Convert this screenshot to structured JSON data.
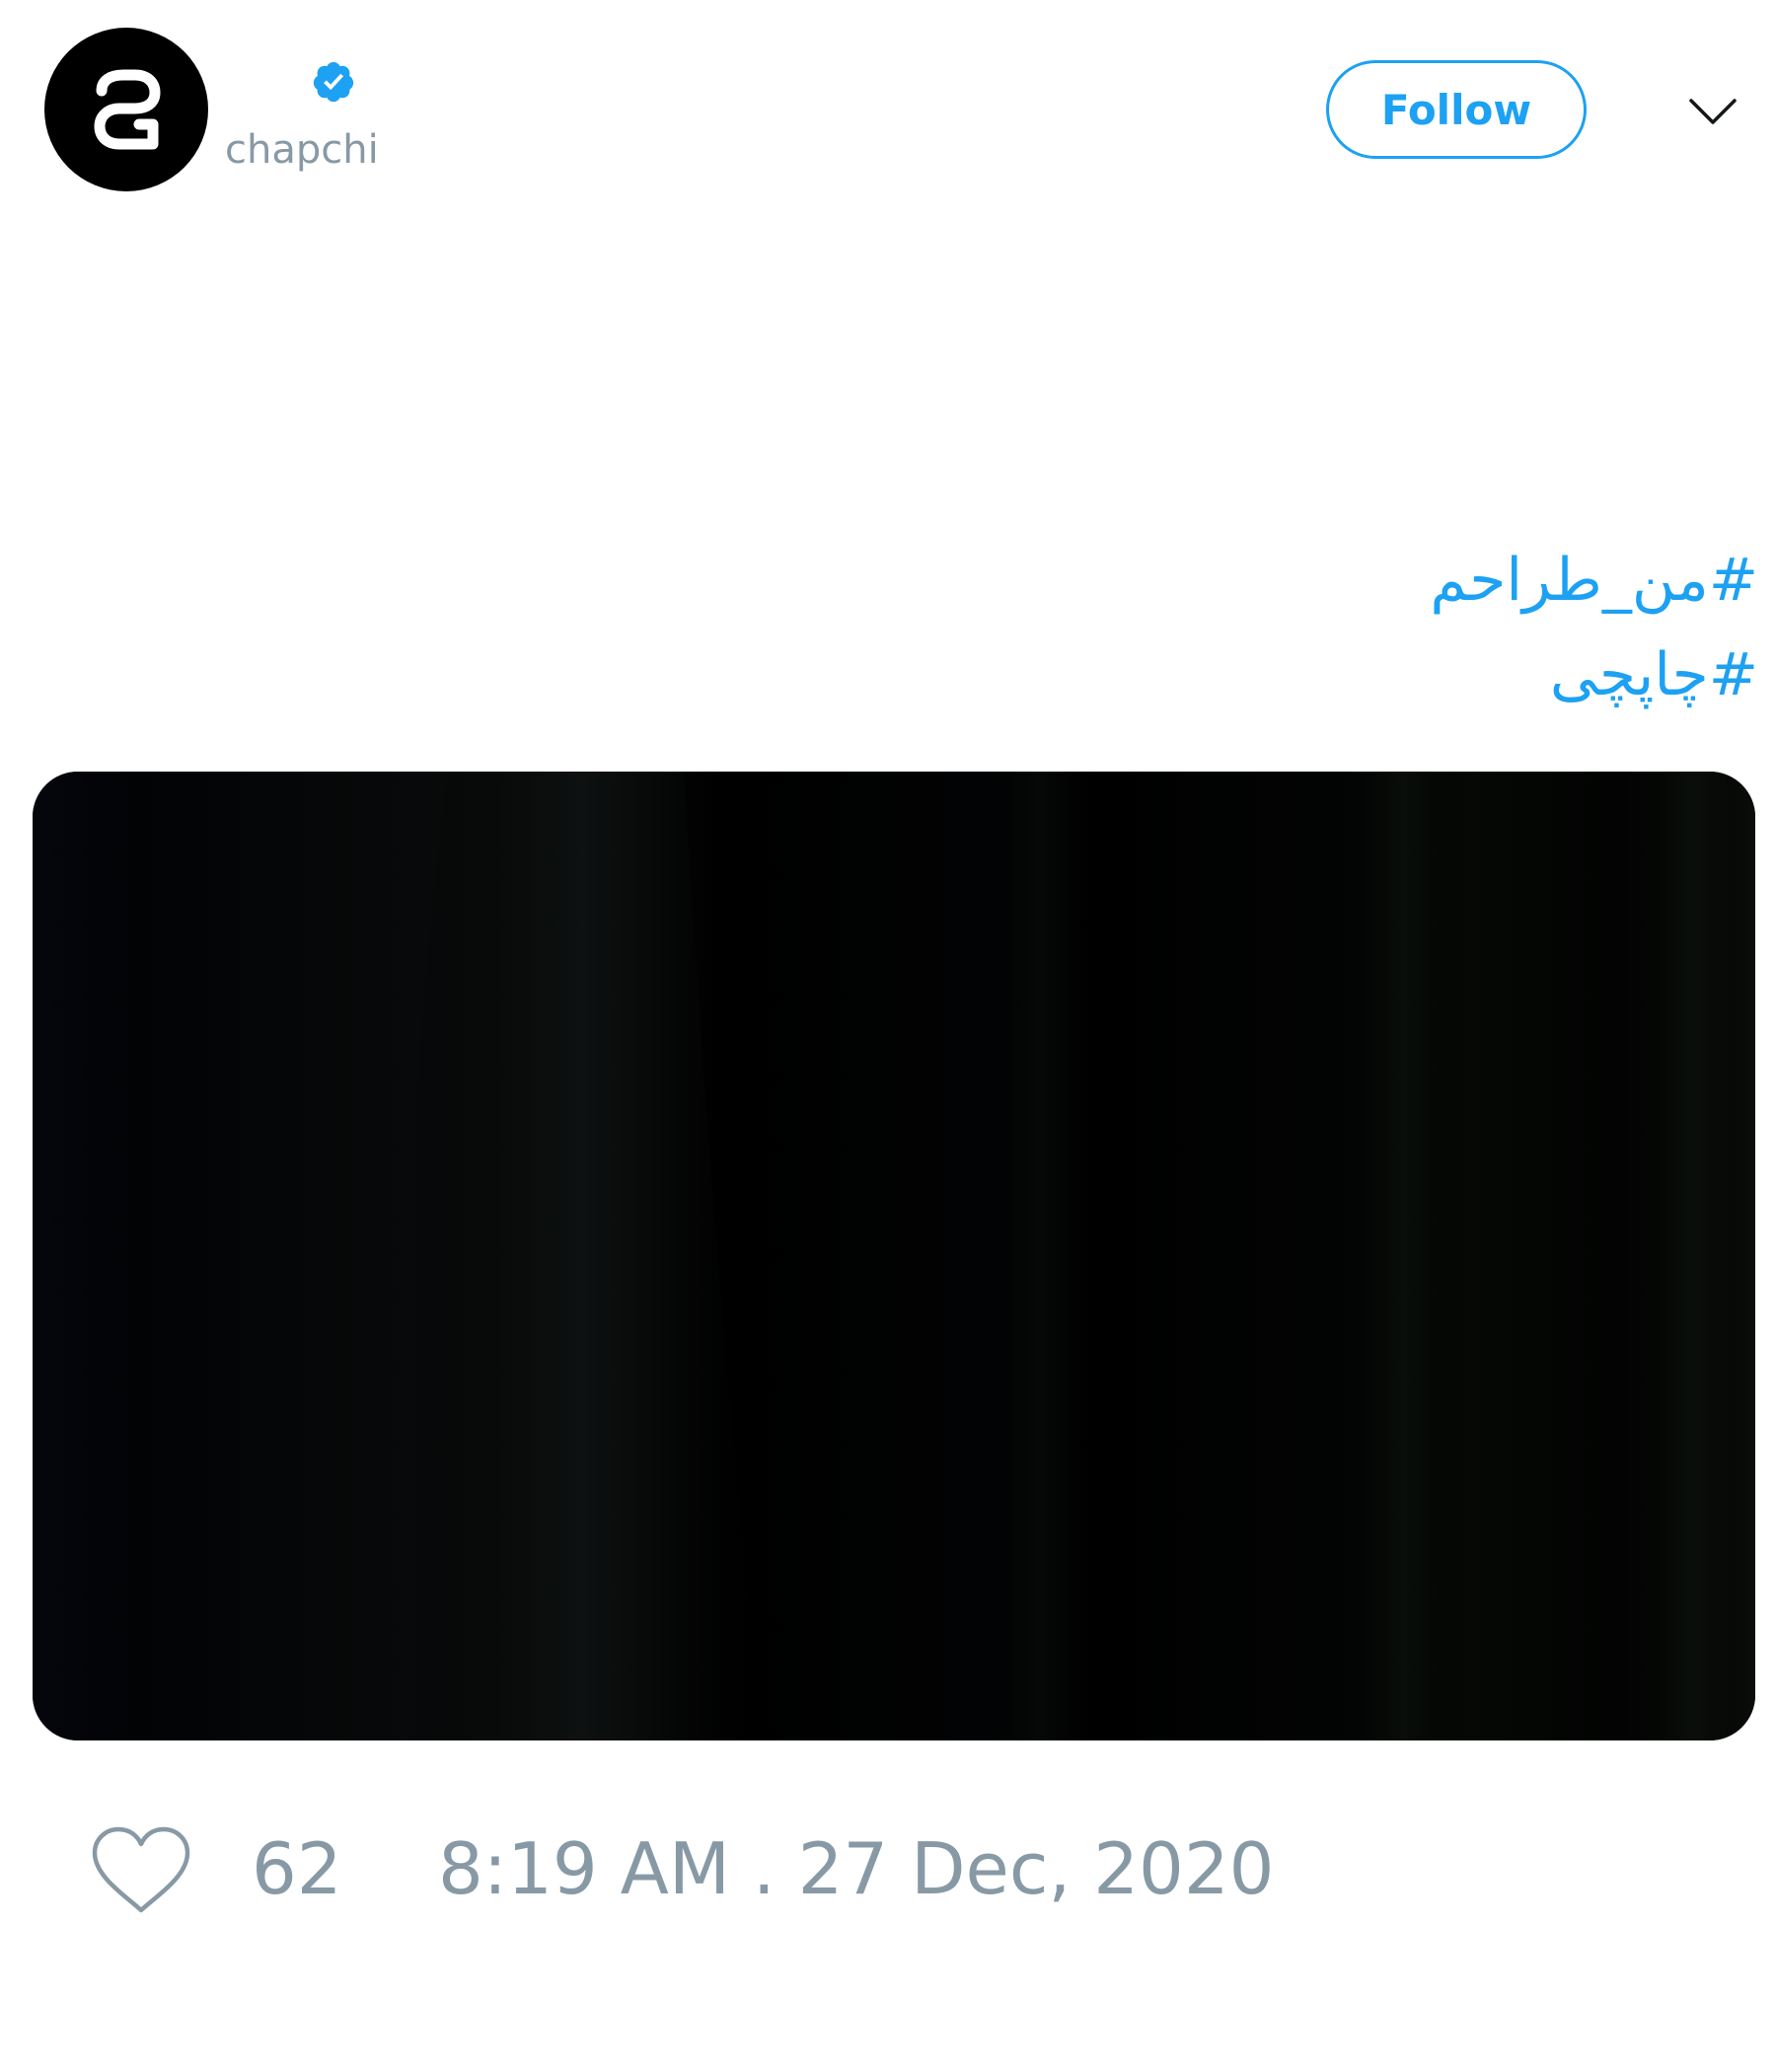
{
  "author": {
    "handle": "chapchi",
    "verified": true,
    "avatar_icon": "chapchi-logo-icon",
    "verified_icon": "verified-badge-icon"
  },
  "header": {
    "follow_label": "Follow",
    "menu_icon": "chevron-down-icon"
  },
  "tweet": {
    "hashtags": [
      "#من_طراحم",
      "#چاپچی"
    ],
    "media": {
      "type": "video-thumbnail",
      "description_icon": "media-thumbnail"
    }
  },
  "footer": {
    "like_icon": "heart-icon",
    "like_count": "62",
    "timestamp": "8:19 AM . 27 Dec, 2020"
  },
  "colors": {
    "accent": "#1da1f2",
    "muted": "#8899a6",
    "background": "#ffffff",
    "avatar_bg": "#000000"
  }
}
